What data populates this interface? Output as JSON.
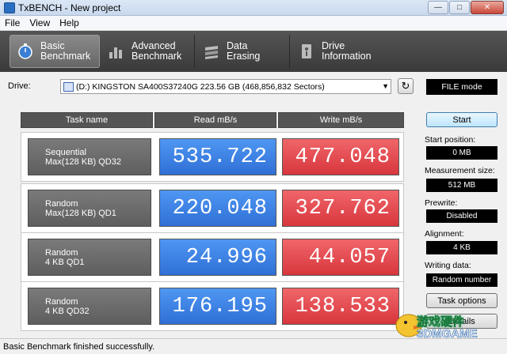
{
  "window": {
    "title": "TxBENCH - New project",
    "minimize": "—",
    "maximize": "□",
    "close": "✕"
  },
  "menu": [
    "File",
    "View",
    "Help"
  ],
  "toolbar": [
    {
      "label": "Basic\nBenchmark",
      "icon": "stopwatch-icon",
      "active": true
    },
    {
      "label": "Advanced\nBenchmark",
      "icon": "bar-chart-icon",
      "active": false
    },
    {
      "label": "Data Erasing",
      "icon": "eraser-icon",
      "active": false
    },
    {
      "label": "Drive\nInformation",
      "icon": "drive-info-icon",
      "active": false
    }
  ],
  "drive": {
    "label": "Drive:",
    "selected": "(D:) KINGSTON SA400S37240G  223.56 GB (468,856,832 Sectors)",
    "mode": "FILE mode"
  },
  "results": {
    "headers": [
      "Task name",
      "Read mB/s",
      "Write mB/s"
    ],
    "rows": [
      {
        "task_line1": "Sequential",
        "task_line2": "Max(128 KB) QD32",
        "read": "535.722",
        "write": "477.048"
      },
      {
        "task_line1": "Random",
        "task_line2": "Max(128 KB) QD1",
        "read": "220.048",
        "write": "327.762"
      },
      {
        "task_line1": "Random",
        "task_line2": "4 KB QD1",
        "read": "24.996",
        "write": "44.057"
      },
      {
        "task_line1": "Random",
        "task_line2": "4 KB QD32",
        "read": "176.195",
        "write": "138.533"
      }
    ]
  },
  "panel": {
    "start": "Start",
    "start_position_label": "Start position:",
    "start_position": "0 MB",
    "measurement_size_label": "Measurement size:",
    "measurement_size": "512 MB",
    "prewrite_label": "Prewrite:",
    "prewrite": "Disabled",
    "alignment_label": "Alignment:",
    "alignment": "4 KB",
    "writing_data_label": "Writing data:",
    "writing_data": "Random number",
    "task_options": "Task options",
    "other": "Details"
  },
  "watermark": {
    "line1": "游戏硬件",
    "line2": "3DMGAME"
  },
  "status": "Basic Benchmark finished successfully.",
  "colors": {
    "read": "#3a82e6",
    "write": "#e04a4f",
    "toolbar": "#444444"
  }
}
